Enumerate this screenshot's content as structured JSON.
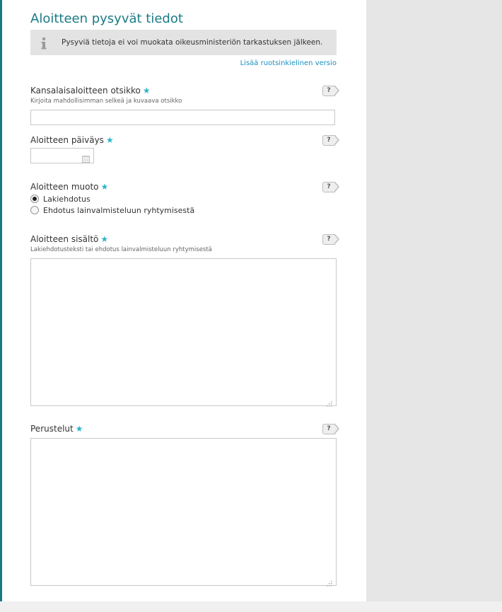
{
  "section": {
    "title": "Aloitteen pysyvät tiedot"
  },
  "info": {
    "text": "Pysyviä tietoja ei voi muokata oikeusministeriön tarkastuksen jälkeen."
  },
  "lang_link": "Lisää ruotsinkielinen versio",
  "required_mark": "★",
  "help_label": "?",
  "fields": {
    "title": {
      "label": "Kansalaisaloitteen otsikko",
      "hint": "Kirjoita mahdollisimman selkeä ja kuvaava otsikko",
      "value": ""
    },
    "date": {
      "label": "Aloitteen päiväys",
      "value": ""
    },
    "form": {
      "label": "Aloitteen muoto",
      "options": [
        {
          "label": "Lakiehdotus",
          "selected": true
        },
        {
          "label": "Ehdotus lainvalmisteluun ryhtymisestä",
          "selected": false
        }
      ]
    },
    "content": {
      "label": "Aloitteen sisältö",
      "hint": "Lakiehdotusteksti tai ehdotus lainvalmisteluun ryhtymisestä",
      "value": ""
    },
    "rationale": {
      "label": "Perustelut",
      "value": ""
    }
  },
  "colors": {
    "accent": "#1a7b84",
    "link": "#1a8fc0",
    "star": "#2fb3c7",
    "page_bg": "#e6e6e6"
  },
  "icons": {
    "info": "info-icon",
    "calendar": "calendar-icon",
    "help": "help-icon",
    "resize": "resize-grip-icon"
  }
}
